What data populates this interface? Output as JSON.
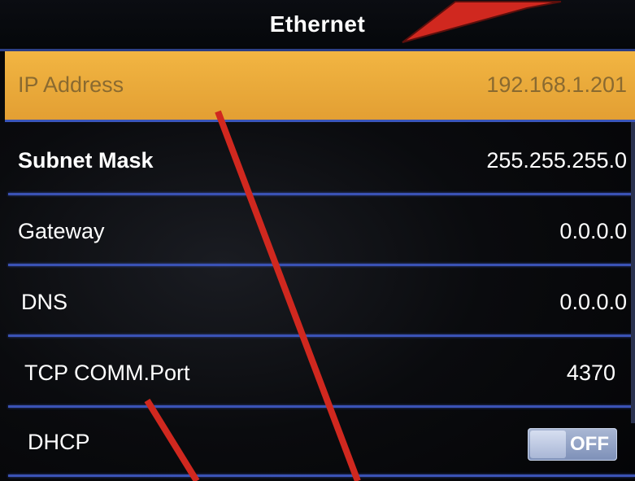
{
  "header": {
    "title": "Ethernet"
  },
  "settings": [
    {
      "label": "IP Address",
      "value": "192.168.1.201",
      "selected": true
    },
    {
      "label": "Subnet Mask",
      "value": "255.255.255.0",
      "selected": false
    },
    {
      "label": "Gateway",
      "value": "0.0.0.0",
      "selected": false
    },
    {
      "label": "DNS",
      "value": "0.0.0.0",
      "selected": false
    },
    {
      "label": "TCP COMM.Port",
      "value": "4370",
      "selected": false
    },
    {
      "label": "DHCP",
      "toggle": "OFF",
      "selected": false
    }
  ],
  "colors": {
    "highlight": "#e9a93a",
    "divider": "#3a52b5",
    "annotation": "#d0281f"
  }
}
